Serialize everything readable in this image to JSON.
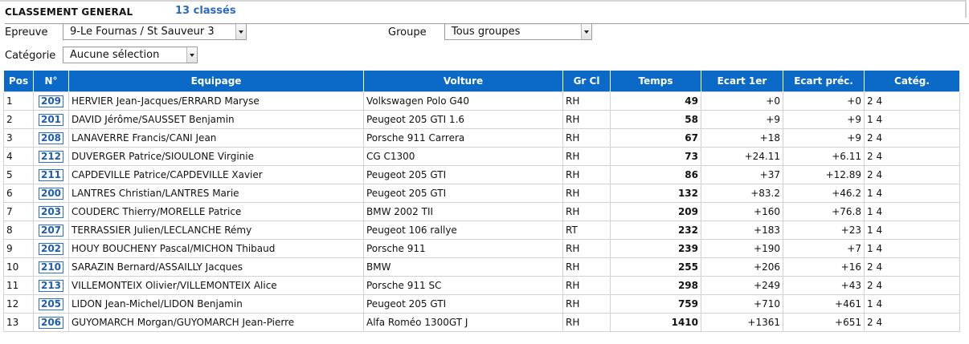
{
  "header": {
    "title": "CLASSEMENT GENERAL",
    "count": "13 classés"
  },
  "filters": {
    "epreuve_label": "Epreuve",
    "epreuve_value": "9-Le Fournas / St Sauveur 3",
    "groupe_label": "Groupe",
    "groupe_value": "Tous groupes",
    "categorie_label": "Catégorie",
    "categorie_value": "Aucune sélection"
  },
  "table": {
    "columns": [
      "Pos",
      "N°",
      "Equipage",
      "Volture",
      "Gr Cl",
      "Temps",
      "Ecart 1er",
      "Ecart préc.",
      "Catég."
    ],
    "rows": [
      {
        "pos": "1",
        "num": "209",
        "equipage": "HERVIER Jean-Jacques/ERRARD Maryse",
        "voiture": "Volkswagen Polo G40",
        "grcl": "RH",
        "temps": "49",
        "ecart1": "+0",
        "ecartp": "+0",
        "categ": "2 4"
      },
      {
        "pos": "2",
        "num": "201",
        "equipage": "DAVID Jérôme/SAUSSET Benjamin",
        "voiture": "Peugeot 205 GTI 1.6",
        "grcl": "RH",
        "temps": "58",
        "ecart1": "+9",
        "ecartp": "+9",
        "categ": "1 4"
      },
      {
        "pos": "3",
        "num": "208",
        "equipage": "LANAVERRE Francis/CANI Jean",
        "voiture": "Porsche 911 Carrera",
        "grcl": "RH",
        "temps": "67",
        "ecart1": "+18",
        "ecartp": "+9",
        "categ": "2 4"
      },
      {
        "pos": "4",
        "num": "212",
        "equipage": "DUVERGER Patrice/SIOULONE Virginie",
        "voiture": "CG C1300",
        "grcl": "RH",
        "temps": "73",
        "ecart1": "+24.11",
        "ecartp": "+6.11",
        "categ": "2 4"
      },
      {
        "pos": "5",
        "num": "211",
        "equipage": "CAPDEVILLE Patrice/CAPDEVILLE Xavier",
        "voiture": "Peugeot 205 GTI",
        "grcl": "RH",
        "temps": "86",
        "ecart1": "+37",
        "ecartp": "+12.89",
        "categ": "2 4"
      },
      {
        "pos": "6",
        "num": "200",
        "equipage": "LANTRES Christian/LANTRES Marie",
        "voiture": "Peugeot 205 GTI",
        "grcl": "RH",
        "temps": "132",
        "ecart1": "+83.2",
        "ecartp": "+46.2",
        "categ": "1 4"
      },
      {
        "pos": "7",
        "num": "203",
        "equipage": "COUDERC Thierry/MORELLE Patrice",
        "voiture": "BMW 2002 TII",
        "grcl": "RH",
        "temps": "209",
        "ecart1": "+160",
        "ecartp": "+76.8",
        "categ": "1 4"
      },
      {
        "pos": "8",
        "num": "207",
        "equipage": "TERRASSIER Julien/LECLANCHE Rémy",
        "voiture": "Peugeot 106 rallye",
        "grcl": "RT",
        "temps": "232",
        "ecart1": "+183",
        "ecartp": "+23",
        "categ": "1 4"
      },
      {
        "pos": "9",
        "num": "202",
        "equipage": "HOUY BOUCHENY Pascal/MICHON Thibaud",
        "voiture": "Porsche 911",
        "grcl": "RH",
        "temps": "239",
        "ecart1": "+190",
        "ecartp": "+7",
        "categ": "1 4"
      },
      {
        "pos": "10",
        "num": "210",
        "equipage": "SARAZIN Bernard/ASSAILLY Jacques",
        "voiture": "BMW",
        "grcl": "RH",
        "temps": "255",
        "ecart1": "+206",
        "ecartp": "+16",
        "categ": "2 4"
      },
      {
        "pos": "11",
        "num": "213",
        "equipage": "VILLEMONTEIX Olivier/VILLEMONTEIX Alice",
        "voiture": "Porsche 911 SC",
        "grcl": "RH",
        "temps": "298",
        "ecart1": "+249",
        "ecartp": "+43",
        "categ": "2 4"
      },
      {
        "pos": "12",
        "num": "205",
        "equipage": "LIDON Jean-Michel/LIDON Benjamin",
        "voiture": "Peugeot 205 GTI",
        "grcl": "RH",
        "temps": "759",
        "ecart1": "+710",
        "ecartp": "+461",
        "categ": "1 4"
      },
      {
        "pos": "13",
        "num": "206",
        "equipage": "GUYOMARCH Morgan/GUYOMARCH Jean-Pierre",
        "voiture": "Alfa Roméo 1300GT J",
        "grcl": "RH",
        "temps": "1410",
        "ecart1": "+1361",
        "ecartp": "+651",
        "categ": "2 4"
      }
    ]
  }
}
